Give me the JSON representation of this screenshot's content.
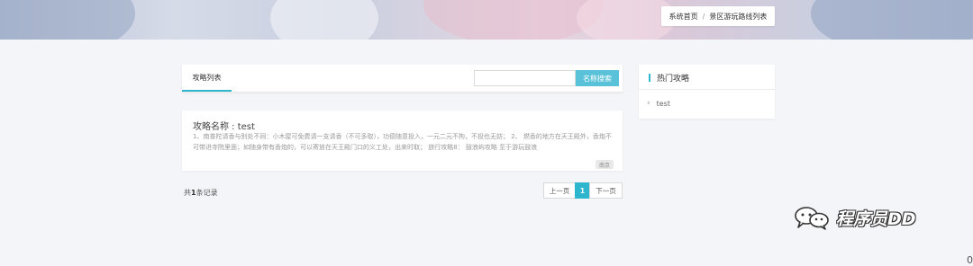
{
  "breadcrumb": {
    "home": "系统首页",
    "separator": "/",
    "current": "景区游玩路线列表"
  },
  "list": {
    "tab_label": "攻略列表",
    "search_placeholder": "",
    "search_value": "",
    "search_button": "名称搜索"
  },
  "article": {
    "title": "攻略名称 : test",
    "description": "1、南普陀请香与别处不同：小木屋可免费请一支请香（不可多取），功德随意投入，一元二元不拘，不投也无妨；       2、 燃香的地方在天王殿外，香炮不可带进寺院里面；如随身带有香炮的，可以寄放在天王殿门口的义工处，出来时取；  旅行攻略8： 鼓浪屿攻略 至于游玩鼓浪",
    "tag": "南京"
  },
  "pagination": {
    "total_prefix": "共",
    "total_count": "1",
    "total_suffix": "条记录",
    "prev": "上一页",
    "current": "1",
    "next": "下一页"
  },
  "sidebar": {
    "title": "热门攻略",
    "items": [
      {
        "label": "test"
      }
    ]
  },
  "watermark": {
    "text": "程序员DD"
  },
  "edge": {
    "digit": "0"
  },
  "colors": {
    "accent": "#2fb6cf",
    "search_button": "#5ac2d8",
    "background": "#f4f5f9"
  },
  "icons": {
    "sidebar_item": "chevron-right-icon",
    "watermark": "wechat-icon"
  }
}
